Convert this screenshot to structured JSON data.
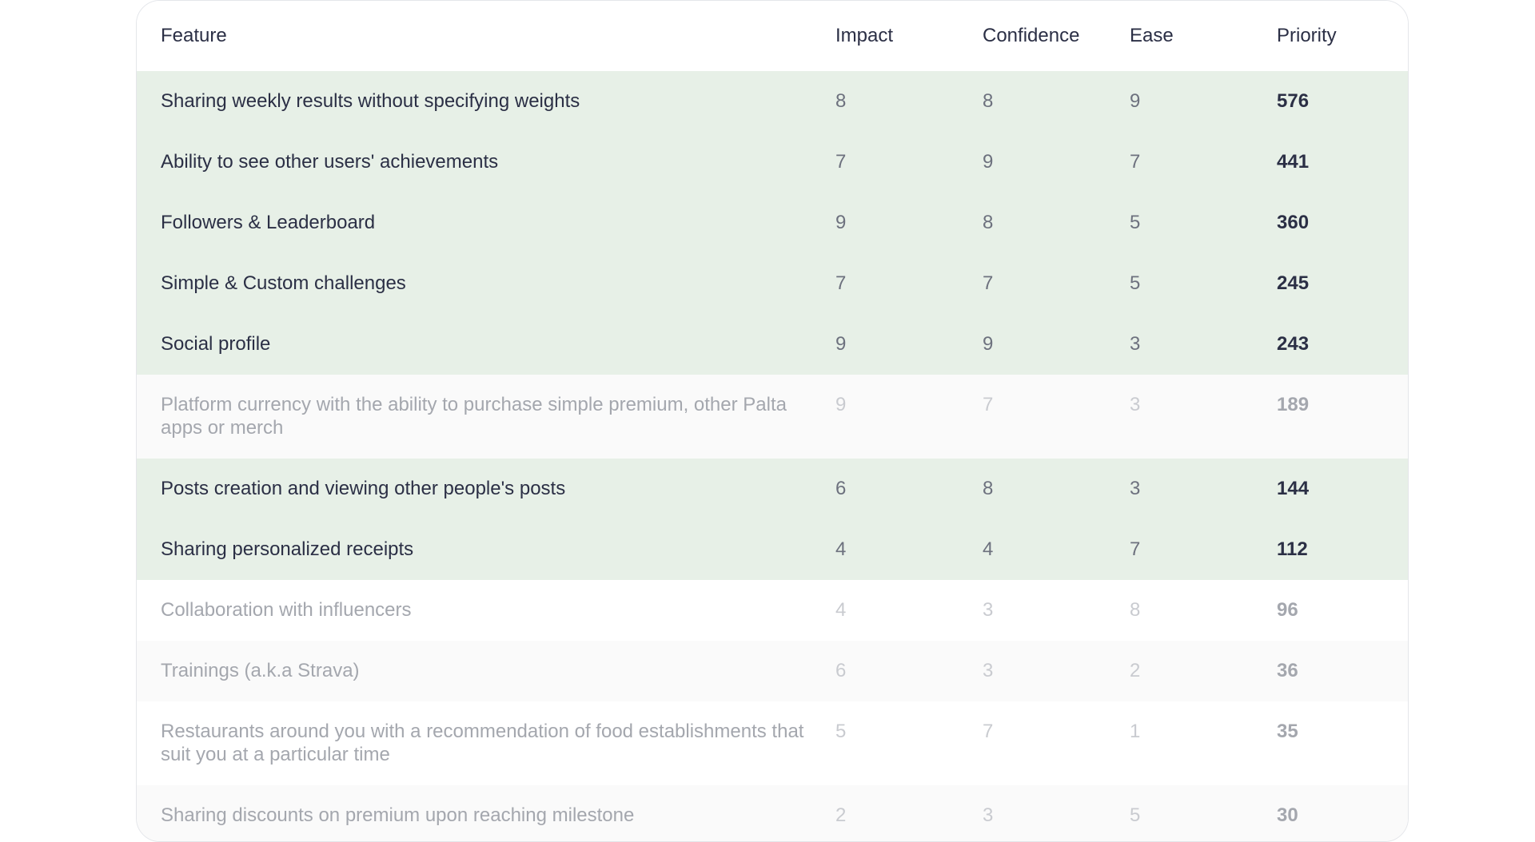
{
  "table": {
    "headers": {
      "feature": "Feature",
      "impact": "Impact",
      "confidence": "Confidence",
      "ease": "Ease",
      "priority": "Priority"
    },
    "rows": [
      {
        "feature": "Sharing weekly results without specifying weights",
        "impact": "8",
        "confidence": "8",
        "ease": "9",
        "priority": "576",
        "highlighted": true
      },
      {
        "feature": "Ability to see other users' achievements",
        "impact": "7",
        "confidence": "9",
        "ease": "7",
        "priority": "441",
        "highlighted": true
      },
      {
        "feature": "Followers & Leaderboard",
        "impact": "9",
        "confidence": "8",
        "ease": "5",
        "priority": "360",
        "highlighted": true
      },
      {
        "feature": "Simple & Custom challenges",
        "impact": "7",
        "confidence": "7",
        "ease": "5",
        "priority": "245",
        "highlighted": true
      },
      {
        "feature": "Social profile",
        "impact": "9",
        "confidence": "9",
        "ease": "3",
        "priority": "243",
        "highlighted": true
      },
      {
        "feature": "Platform currency with the ability to purchase simple premium, other Palta apps or merch",
        "impact": "9",
        "confidence": "7",
        "ease": "3",
        "priority": "189",
        "highlighted": false
      },
      {
        "feature": "Posts creation and viewing other people's posts",
        "impact": "6",
        "confidence": "8",
        "ease": "3",
        "priority": "144",
        "highlighted": true
      },
      {
        "feature": "Sharing personalized receipts",
        "impact": "4",
        "confidence": "4",
        "ease": "7",
        "priority": "112",
        "highlighted": true
      },
      {
        "feature": "Collaboration with influencers",
        "impact": "4",
        "confidence": "3",
        "ease": "8",
        "priority": "96",
        "highlighted": false
      },
      {
        "feature": "Trainings (a.k.a Strava)",
        "impact": "6",
        "confidence": "3",
        "ease": "2",
        "priority": "36",
        "highlighted": false
      },
      {
        "feature": "Restaurants around you with a recommendation of food establishments that suit you at a particular time",
        "impact": "5",
        "confidence": "7",
        "ease": "1",
        "priority": "35",
        "highlighted": false
      },
      {
        "feature": "Sharing discounts on premium upon reaching milestone",
        "impact": "2",
        "confidence": "3",
        "ease": "5",
        "priority": "30",
        "highlighted": false
      }
    ]
  },
  "colors": {
    "highlight_row": "#e7f0e7",
    "text_primary": "#2b2f45",
    "text_muted": "#a4a7ae"
  }
}
